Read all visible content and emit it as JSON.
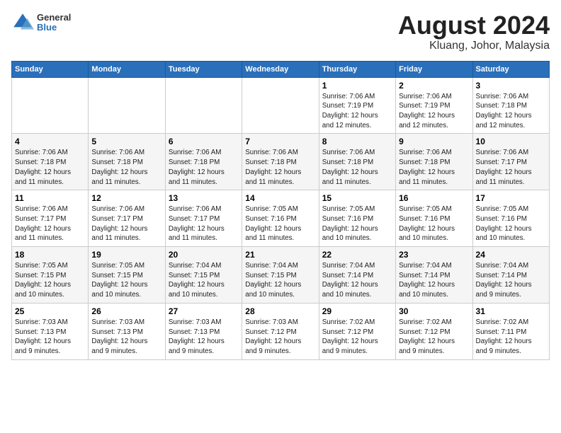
{
  "header": {
    "logo_general": "General",
    "logo_blue": "Blue",
    "title": "August 2024",
    "subtitle": "Kluang, Johor, Malaysia"
  },
  "weekdays": [
    "Sunday",
    "Monday",
    "Tuesday",
    "Wednesday",
    "Thursday",
    "Friday",
    "Saturday"
  ],
  "weeks": [
    [
      {
        "day": "",
        "info": ""
      },
      {
        "day": "",
        "info": ""
      },
      {
        "day": "",
        "info": ""
      },
      {
        "day": "",
        "info": ""
      },
      {
        "day": "1",
        "info": "Sunrise: 7:06 AM\nSunset: 7:19 PM\nDaylight: 12 hours\nand 12 minutes."
      },
      {
        "day": "2",
        "info": "Sunrise: 7:06 AM\nSunset: 7:19 PM\nDaylight: 12 hours\nand 12 minutes."
      },
      {
        "day": "3",
        "info": "Sunrise: 7:06 AM\nSunset: 7:18 PM\nDaylight: 12 hours\nand 12 minutes."
      }
    ],
    [
      {
        "day": "4",
        "info": "Sunrise: 7:06 AM\nSunset: 7:18 PM\nDaylight: 12 hours\nand 11 minutes."
      },
      {
        "day": "5",
        "info": "Sunrise: 7:06 AM\nSunset: 7:18 PM\nDaylight: 12 hours\nand 11 minutes."
      },
      {
        "day": "6",
        "info": "Sunrise: 7:06 AM\nSunset: 7:18 PM\nDaylight: 12 hours\nand 11 minutes."
      },
      {
        "day": "7",
        "info": "Sunrise: 7:06 AM\nSunset: 7:18 PM\nDaylight: 12 hours\nand 11 minutes."
      },
      {
        "day": "8",
        "info": "Sunrise: 7:06 AM\nSunset: 7:18 PM\nDaylight: 12 hours\nand 11 minutes."
      },
      {
        "day": "9",
        "info": "Sunrise: 7:06 AM\nSunset: 7:18 PM\nDaylight: 12 hours\nand 11 minutes."
      },
      {
        "day": "10",
        "info": "Sunrise: 7:06 AM\nSunset: 7:17 PM\nDaylight: 12 hours\nand 11 minutes."
      }
    ],
    [
      {
        "day": "11",
        "info": "Sunrise: 7:06 AM\nSunset: 7:17 PM\nDaylight: 12 hours\nand 11 minutes."
      },
      {
        "day": "12",
        "info": "Sunrise: 7:06 AM\nSunset: 7:17 PM\nDaylight: 12 hours\nand 11 minutes."
      },
      {
        "day": "13",
        "info": "Sunrise: 7:06 AM\nSunset: 7:17 PM\nDaylight: 12 hours\nand 11 minutes."
      },
      {
        "day": "14",
        "info": "Sunrise: 7:05 AM\nSunset: 7:16 PM\nDaylight: 12 hours\nand 11 minutes."
      },
      {
        "day": "15",
        "info": "Sunrise: 7:05 AM\nSunset: 7:16 PM\nDaylight: 12 hours\nand 10 minutes."
      },
      {
        "day": "16",
        "info": "Sunrise: 7:05 AM\nSunset: 7:16 PM\nDaylight: 12 hours\nand 10 minutes."
      },
      {
        "day": "17",
        "info": "Sunrise: 7:05 AM\nSunset: 7:16 PM\nDaylight: 12 hours\nand 10 minutes."
      }
    ],
    [
      {
        "day": "18",
        "info": "Sunrise: 7:05 AM\nSunset: 7:15 PM\nDaylight: 12 hours\nand 10 minutes."
      },
      {
        "day": "19",
        "info": "Sunrise: 7:05 AM\nSunset: 7:15 PM\nDaylight: 12 hours\nand 10 minutes."
      },
      {
        "day": "20",
        "info": "Sunrise: 7:04 AM\nSunset: 7:15 PM\nDaylight: 12 hours\nand 10 minutes."
      },
      {
        "day": "21",
        "info": "Sunrise: 7:04 AM\nSunset: 7:15 PM\nDaylight: 12 hours\nand 10 minutes."
      },
      {
        "day": "22",
        "info": "Sunrise: 7:04 AM\nSunset: 7:14 PM\nDaylight: 12 hours\nand 10 minutes."
      },
      {
        "day": "23",
        "info": "Sunrise: 7:04 AM\nSunset: 7:14 PM\nDaylight: 12 hours\nand 10 minutes."
      },
      {
        "day": "24",
        "info": "Sunrise: 7:04 AM\nSunset: 7:14 PM\nDaylight: 12 hours\nand 9 minutes."
      }
    ],
    [
      {
        "day": "25",
        "info": "Sunrise: 7:03 AM\nSunset: 7:13 PM\nDaylight: 12 hours\nand 9 minutes."
      },
      {
        "day": "26",
        "info": "Sunrise: 7:03 AM\nSunset: 7:13 PM\nDaylight: 12 hours\nand 9 minutes."
      },
      {
        "day": "27",
        "info": "Sunrise: 7:03 AM\nSunset: 7:13 PM\nDaylight: 12 hours\nand 9 minutes."
      },
      {
        "day": "28",
        "info": "Sunrise: 7:03 AM\nSunset: 7:12 PM\nDaylight: 12 hours\nand 9 minutes."
      },
      {
        "day": "29",
        "info": "Sunrise: 7:02 AM\nSunset: 7:12 PM\nDaylight: 12 hours\nand 9 minutes."
      },
      {
        "day": "30",
        "info": "Sunrise: 7:02 AM\nSunset: 7:12 PM\nDaylight: 12 hours\nand 9 minutes."
      },
      {
        "day": "31",
        "info": "Sunrise: 7:02 AM\nSunset: 7:11 PM\nDaylight: 12 hours\nand 9 minutes."
      }
    ]
  ]
}
